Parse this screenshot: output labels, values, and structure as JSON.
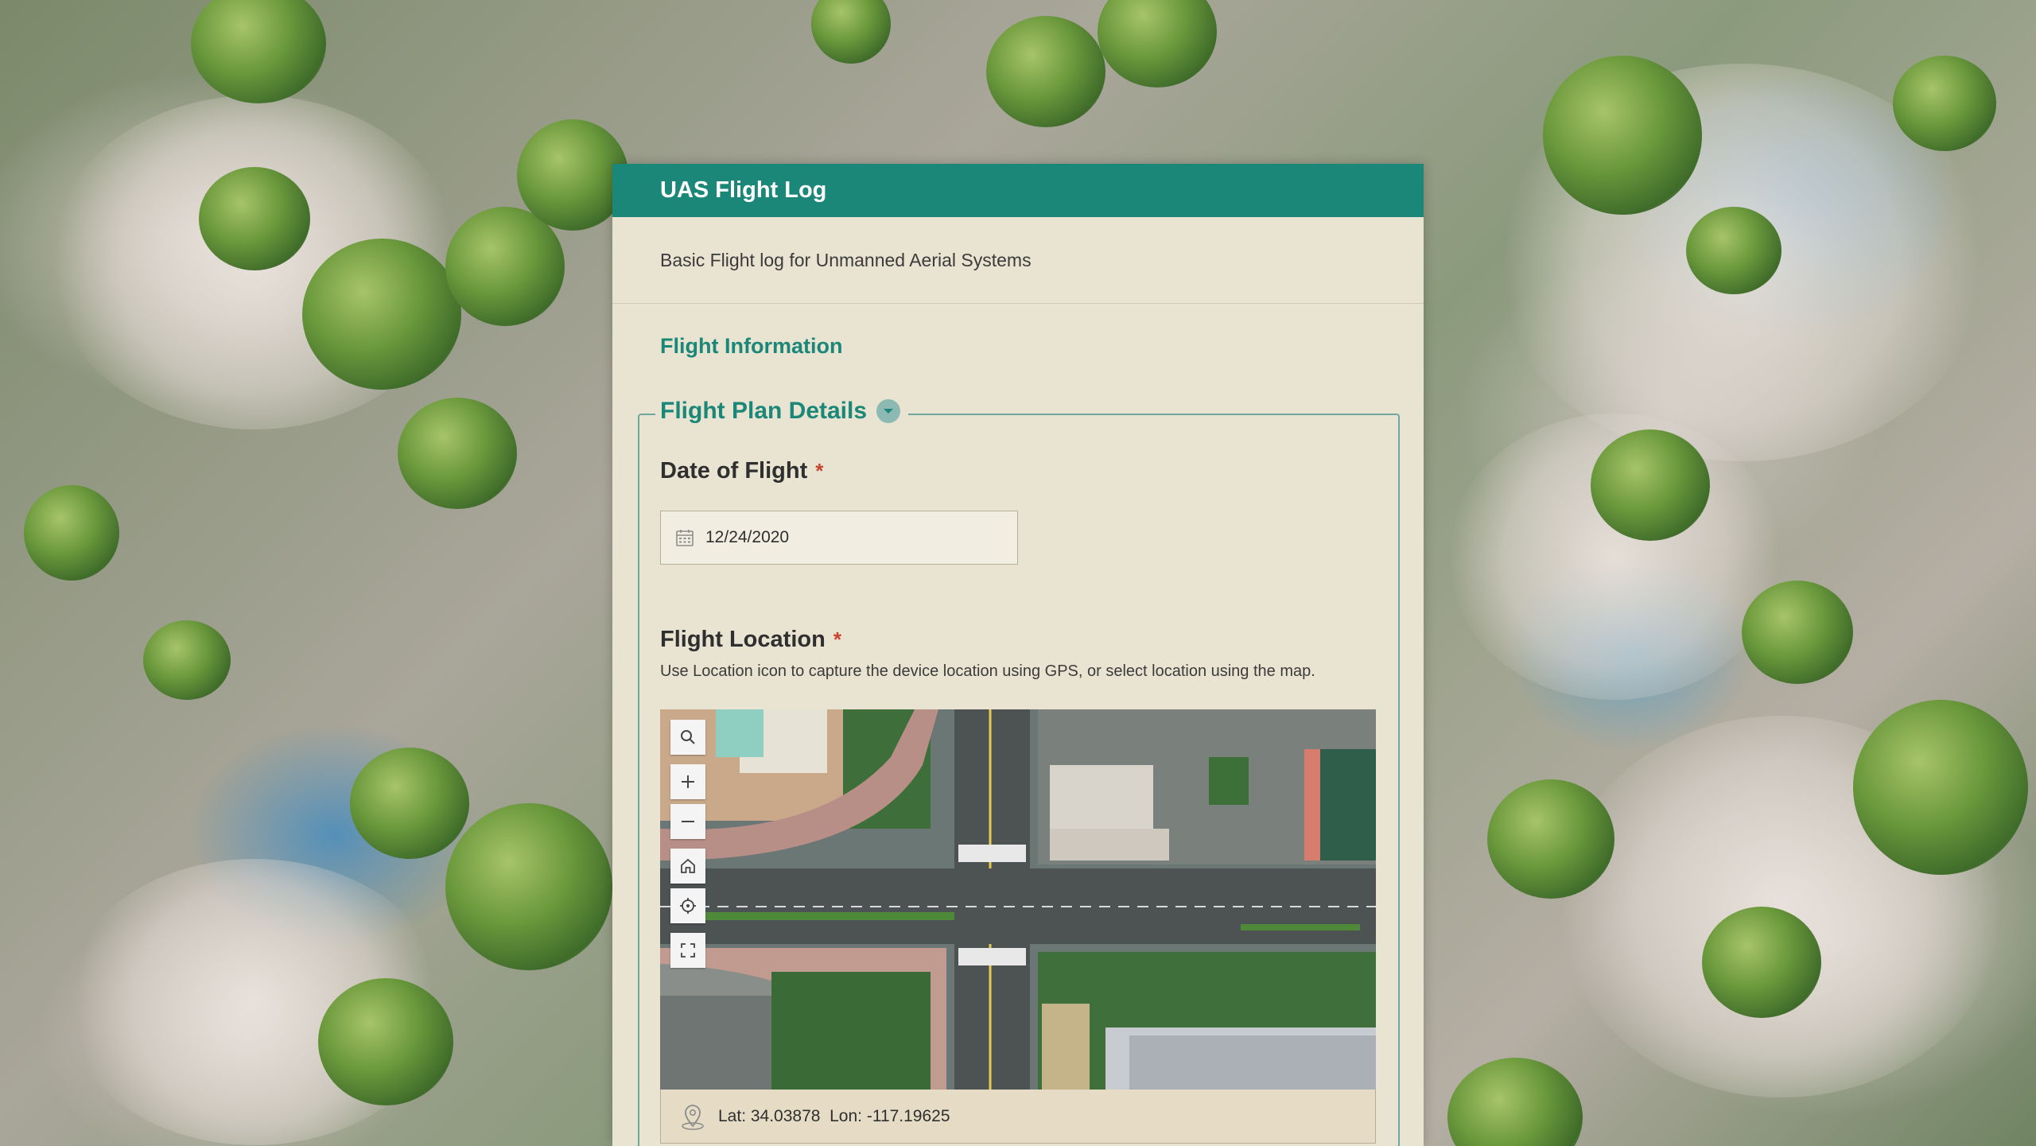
{
  "form": {
    "title": "UAS Flight Log",
    "description": "Basic Flight log for Unmanned Aerial Systems",
    "section_title": "Flight Information",
    "group": {
      "title": "Flight Plan Details",
      "collapse_icon": "chevron-down-icon"
    },
    "date_of_flight": {
      "label": "Date of Flight",
      "required_mark": "*",
      "value": "12/24/2020",
      "icon": "calendar-icon"
    },
    "flight_location": {
      "label": "Flight Location",
      "required_mark": "*",
      "hint": "Use Location icon to capture the device location using GPS, or select location using the map.",
      "map_tools": [
        "search-icon",
        "zoom-in-icon",
        "zoom-out-icon",
        "home-icon",
        "locate-icon",
        "fullscreen-icon"
      ],
      "coordinates": "Lat: 34.03878  Lon: -117.19625",
      "coordinates_icon": "location-pin-icon"
    }
  },
  "colors": {
    "header": "#1b8778",
    "accent": "#1b8778",
    "required": "#c8432d",
    "panel": "#e9e3d1"
  }
}
